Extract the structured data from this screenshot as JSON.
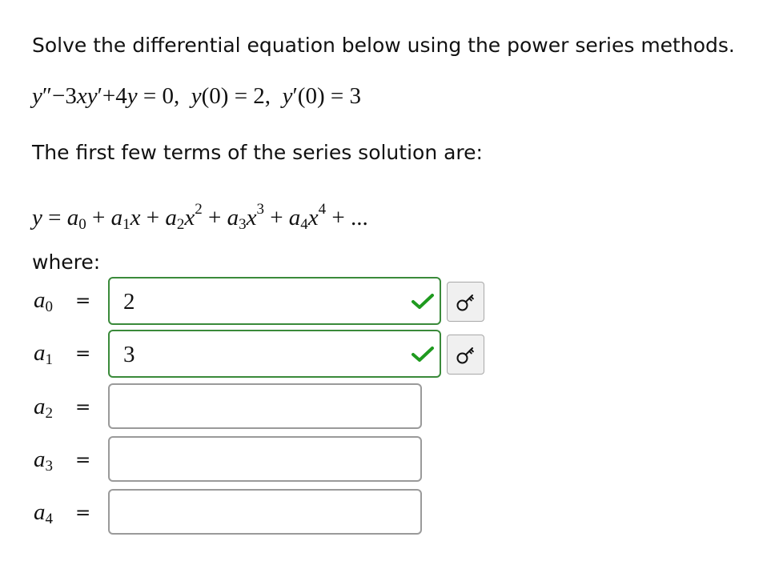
{
  "question": {
    "prompt": "Solve the differential equation below using the power series methods."
  },
  "ode": {
    "y": "y",
    "pp": "″",
    "minus": "−",
    "three": "3",
    "x": "x",
    "p": "′",
    "plus": "+",
    "four": "4",
    "eqzero": " = 0,",
    "sep1": "  ",
    "y0": "(0) = 2,",
    "sep2": "  ",
    "yp0": "(0) = 3"
  },
  "series_intro": "The first few terms of the series solution are:",
  "series": {
    "lhs": "y",
    "eq": " = ",
    "a": "a",
    "x": "x",
    "plus": " + ",
    "i0": "0",
    "i1": "1",
    "i2": "2",
    "i3": "3",
    "i4": "4",
    "e2": "2",
    "e3": "3",
    "e4": "4",
    "tail": " + ..."
  },
  "where_label": "where:",
  "coefficients": [
    {
      "symbol": "a",
      "index": "0",
      "equals": "=",
      "value": "2",
      "status": "correct"
    },
    {
      "symbol": "a",
      "index": "1",
      "equals": "=",
      "value": "3",
      "status": "correct"
    },
    {
      "symbol": "a",
      "index": "2",
      "equals": "=",
      "value": "",
      "status": "empty"
    },
    {
      "symbol": "a",
      "index": "3",
      "equals": "=",
      "value": "",
      "status": "empty"
    },
    {
      "symbol": "a",
      "index": "4",
      "equals": "=",
      "value": "",
      "status": "empty"
    }
  ],
  "icons": {
    "correct": "checkmark-icon",
    "answer_key": "key-icon"
  },
  "colors": {
    "correct_border": "#3a8a3a",
    "check": "#1f9a1f",
    "empty_border": "#9a9a9a"
  }
}
